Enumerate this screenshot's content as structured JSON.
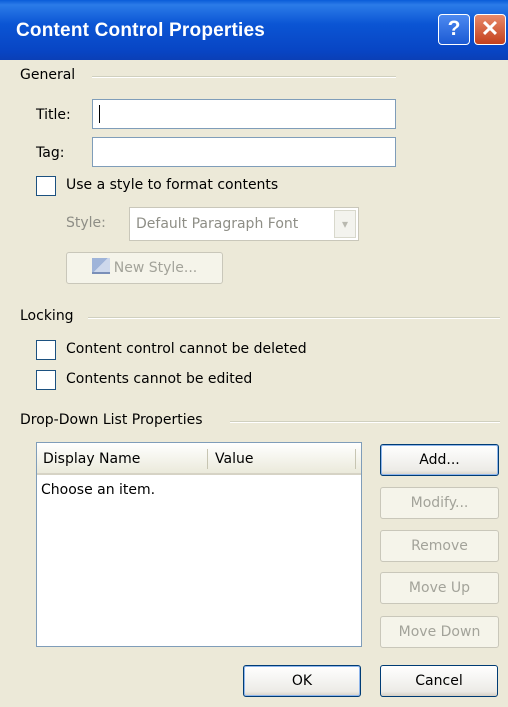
{
  "window": {
    "title": "Content Control Properties",
    "help_label": "?",
    "close_label": "✕"
  },
  "general": {
    "heading": "General",
    "title_label": "Title:",
    "title_value": "",
    "tag_label": "Tag:",
    "tag_value": "",
    "use_style_label": "Use a style to format contents",
    "style_label": "Style:",
    "style_value": "Default Paragraph Font",
    "new_style_label": "New Style..."
  },
  "locking": {
    "heading": "Locking",
    "cannot_delete_label": "Content control cannot be deleted",
    "cannot_edit_label": "Contents cannot be edited"
  },
  "dropdown": {
    "heading": "Drop-Down List Properties",
    "columns": [
      "Display Name",
      "Value"
    ],
    "rows": [
      {
        "display_name": "Choose an item.",
        "value": ""
      }
    ],
    "buttons": {
      "add": "Add...",
      "modify": "Modify...",
      "remove": "Remove",
      "move_up": "Move Up",
      "move_down": "Move Down"
    }
  },
  "footer": {
    "ok": "OK",
    "cancel": "Cancel"
  },
  "icons": {
    "help": "help-icon",
    "close": "close-icon",
    "dropdown": "chevron-down-icon",
    "new_style": "new-style-icon"
  },
  "colors": {
    "titlebar": "#0a55d4",
    "dialog_bg": "#ece9d8",
    "close": "#c4401c"
  }
}
